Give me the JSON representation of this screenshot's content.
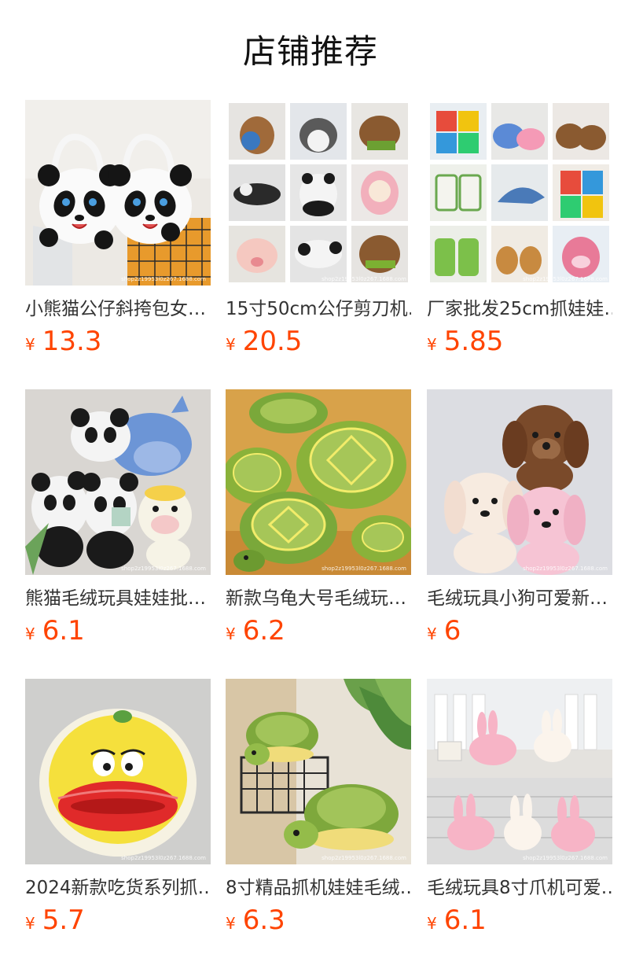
{
  "header": {
    "title": "店铺推荐"
  },
  "currency_symbol": "¥",
  "watermark": "shop2z19953l0z267.1688.com",
  "products": [
    {
      "name": "小熊猫公仔斜挎包女…",
      "price": "13.3",
      "image": "panda-shoulder-bags"
    },
    {
      "name": "15寸50cm公仔剪刀机…",
      "price": "20.5",
      "image": "plush-collage-3x3"
    },
    {
      "name": "厂家批发25cm抓娃娃…",
      "price": "5.85",
      "image": "toy-collage-3x3"
    },
    {
      "name": "熊猫毛绒玩具娃娃批…",
      "price": "6.1",
      "image": "pandas-and-cow-plush"
    },
    {
      "name": "新款乌龟大号毛绒玩…",
      "price": "6.2",
      "image": "green-turtle-plush"
    },
    {
      "name": "毛绒玩具小狗可爱新…",
      "price": "6",
      "image": "puppy-plush"
    },
    {
      "name": "2024新款吃货系列抓…",
      "price": "5.7",
      "image": "yellow-lips-plush"
    },
    {
      "name": "8寸精品抓机娃娃毛绒…",
      "price": "6.3",
      "image": "turtles-on-basket"
    },
    {
      "name": "毛绒玩具8寸爪机可爱…",
      "price": "6.1",
      "image": "pink-rabbit-plush"
    }
  ],
  "colors": {
    "price": "#ff4400",
    "title": "#111111",
    "text": "#333333",
    "background": "#ffffff"
  }
}
